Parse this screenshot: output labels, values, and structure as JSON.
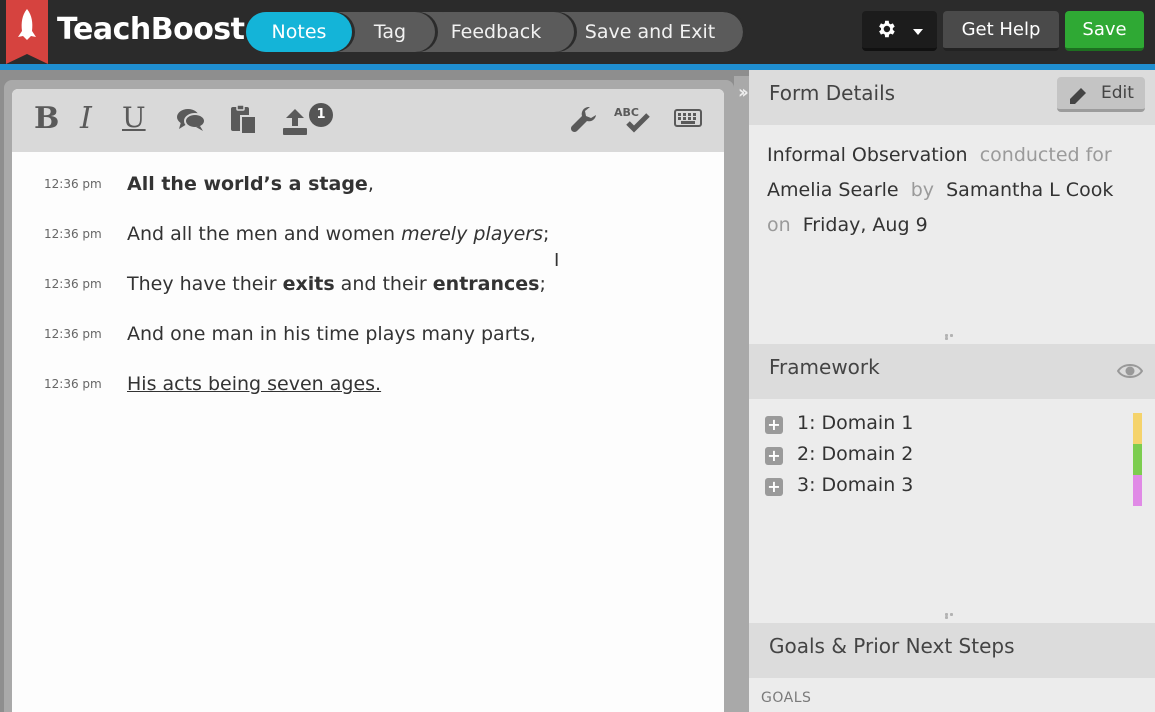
{
  "app": {
    "brand": "TeachBoost"
  },
  "nav": {
    "steps": [
      {
        "label": "Notes",
        "active": true
      },
      {
        "label": "Tag",
        "active": false
      },
      {
        "label": "Feedback",
        "active": false
      },
      {
        "label": "Save and Exit",
        "active": false
      }
    ],
    "settings_icon": "gear-icon",
    "help_label": "Get Help",
    "save_label": "Save"
  },
  "toolbar": {
    "bold": "B",
    "italic": "I",
    "underline": "U",
    "attachments_count": "1",
    "spellcheck_label": "ABC",
    "icons": [
      "bold-icon",
      "italic-icon",
      "underline-icon",
      "comment-icon",
      "clipboard-icon",
      "upload-icon",
      "wrench-icon",
      "spellcheck-icon",
      "keyboard-icon"
    ]
  },
  "notes": [
    {
      "time": "12:36 pm",
      "text": "All the world’s a stage,"
    },
    {
      "time": "12:36 pm",
      "text": "And all the men and women merely players;"
    },
    {
      "time": "12:36 pm",
      "text": "They have their exits and their entrances;"
    },
    {
      "time": "12:36 pm",
      "text": "And one man in his time plays many parts,"
    },
    {
      "time": "12:36 pm",
      "text": "His acts being seven ages."
    }
  ],
  "form_details": {
    "title": "Form Details",
    "edit_label": "Edit",
    "form_type": "Informal Observation",
    "conducted_for_label": "conducted for",
    "teacher": "Amelia Searle",
    "by_label": "by",
    "observer": "Samantha L Cook",
    "on_label": "on",
    "date": "Friday, Aug 9"
  },
  "framework": {
    "title": "Framework",
    "domains": [
      {
        "label": "1: Domain 1",
        "color": "#f5d36b"
      },
      {
        "label": "2: Domain 2",
        "color": "#7ccd4f"
      },
      {
        "label": "3: Domain 3",
        "color": "#e08ae6"
      }
    ]
  },
  "goals": {
    "title": "Goals & Prior Next Steps",
    "goals_label": "GOALS"
  }
}
